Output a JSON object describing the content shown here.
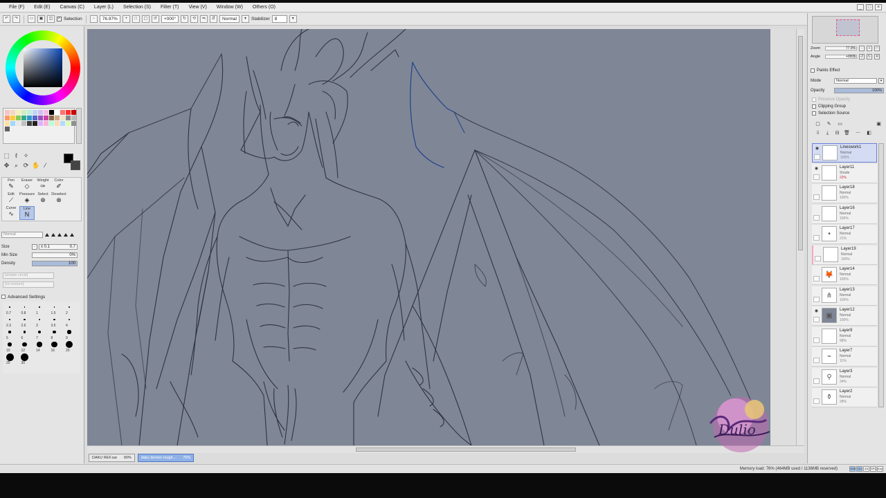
{
  "menu": [
    "File (F)",
    "Edit (E)",
    "Canvas (C)",
    "Layer (L)",
    "Selection (S)",
    "Filter (T)",
    "View (V)",
    "Window (W)",
    "Others (O)"
  ],
  "window_controls": [
    "_",
    "□",
    "×"
  ],
  "toolbar": {
    "selection_label": "Selection",
    "zoom": "76.97%",
    "angle": "+000°",
    "mode": "Normal",
    "stabilizer_label": "Stabilizer",
    "stabilizer_value": "8"
  },
  "brushes": [
    {
      "label": "Pen",
      "icon": "✎"
    },
    {
      "label": "Eraser",
      "icon": "◇"
    },
    {
      "label": "Weight",
      "icon": "✑"
    },
    {
      "label": "Color",
      "icon": "✐"
    },
    {
      "label": "Edit",
      "icon": "⟋"
    },
    {
      "label": "Pressure",
      "icon": "◈"
    },
    {
      "label": "Select",
      "icon": "⊕"
    },
    {
      "label": "Deselect",
      "icon": "⊗"
    },
    {
      "label": "Curve",
      "icon": "∿"
    },
    {
      "label": "Line",
      "icon": "N"
    }
  ],
  "brush_props": {
    "mode": "Normal",
    "size_label": "Size",
    "size_mult": "x 0.1",
    "size_value": "0.7",
    "min_size_label": "Min Size",
    "min_size_value": "0%",
    "min_size_fraction": 0,
    "density_label": "Density",
    "density_value": "100",
    "density_fraction": 1.0,
    "blend": "[simple circle]",
    "texture": "[no texture]",
    "advanced_label": "Advanced Settings"
  },
  "dot_sizes": [
    "0.7",
    "0.8",
    "1",
    "1.5",
    "2",
    "2.3",
    "2.6",
    "3",
    "3.5",
    "4",
    "5",
    "6",
    "7",
    "8",
    "9",
    "10",
    "12",
    "14",
    "16",
    "20",
    "25",
    "30"
  ],
  "tabs": [
    {
      "name": "DAKU REF.sai",
      "zoom": "90%"
    },
    {
      "name": "daku demon rough...",
      "zoom": "76%"
    }
  ],
  "navigator": {
    "zoom_label": "Zoom",
    "zoom_value": "77.0%",
    "angle_label": "Angle",
    "angle_value": "+000$"
  },
  "layer_panel": {
    "effect_label": "Paints Effect",
    "mode_label": "Mode",
    "mode_value": "Normal",
    "opacity_label": "Opacity",
    "opacity_value": "100%",
    "opacity_fraction": 1.0,
    "preserve_opacity": "Preserve Opacity",
    "clipping_group": "Clipping Group",
    "selection_source": "Selection Source"
  },
  "layers": [
    {
      "name": "Lineswork1",
      "mode": "Normal",
      "opacity": "100%",
      "visible": true,
      "selected": true
    },
    {
      "name": "Layer11",
      "mode": "Shade",
      "opacity": "22%",
      "visible": true
    },
    {
      "name": "Layer18",
      "mode": "Normal",
      "opacity": "100%",
      "visible": false
    },
    {
      "name": "Layer16",
      "mode": "Normal",
      "opacity": "100%",
      "visible": false
    },
    {
      "name": "Layer17",
      "mode": "Normal",
      "opacity": "21%",
      "visible": false
    },
    {
      "name": "Layer19",
      "mode": "Normal",
      "opacity": "100%",
      "visible": false
    },
    {
      "name": "Layer14",
      "mode": "Normal",
      "opacity": "100%",
      "visible": false
    },
    {
      "name": "Layer13",
      "mode": "Normal",
      "opacity": "100%",
      "visible": false
    },
    {
      "name": "Layer12",
      "mode": "Normal",
      "opacity": "100%",
      "visible": true
    },
    {
      "name": "Layer9",
      "mode": "Normal",
      "opacity": "98%",
      "visible": false
    },
    {
      "name": "Layer7",
      "mode": "Normal",
      "opacity": "11%",
      "visible": false
    },
    {
      "name": "Layer3",
      "mode": "Normal",
      "opacity": "34%",
      "visible": false
    },
    {
      "name": "Layer2",
      "mode": "Normal",
      "opacity": "28%",
      "visible": false
    }
  ],
  "status": {
    "memory": "Memory load: 76% (464MB used / 1136MB reserved)",
    "icons": [
      "Shift",
      "Ctrl",
      "Alt",
      "SPC",
      "Any"
    ]
  },
  "watermark": "Dulio",
  "colors": {
    "canvas": "#7f8696",
    "accent": "#6a7fd8",
    "fg_color": "#000000",
    "bg_color": "#444444"
  },
  "palette": [
    "#f5c4c4",
    "#f5d6bd",
    "#f5efbd",
    "#cdeebd",
    "#bdeee0",
    "#bdd6f5",
    "#d2bdf5",
    "#f5bde4",
    "#000000",
    "#ffffff",
    "#ff7272",
    "#ff3030",
    "#cc0000",
    "#ff9966",
    "#ffcc33",
    "#88cc55",
    "#33aa88",
    "#3399cc",
    "#5566cc",
    "#9955bb",
    "#cc44aa",
    "#8a6a4a",
    "#cfa98a",
    "#f2e1c8",
    "#888888",
    "#bbbbbb",
    "#ffe0a0",
    "#a0d8ff",
    "#e8e8e8",
    "#c0c0c0",
    "#404040",
    "#202020",
    "#d9b3ff",
    "#ffb3d9",
    "#b3ffd9",
    "#ffd9b3",
    "#b3d9ff",
    "#d9ffb3",
    "#909090",
    "#606060"
  ]
}
